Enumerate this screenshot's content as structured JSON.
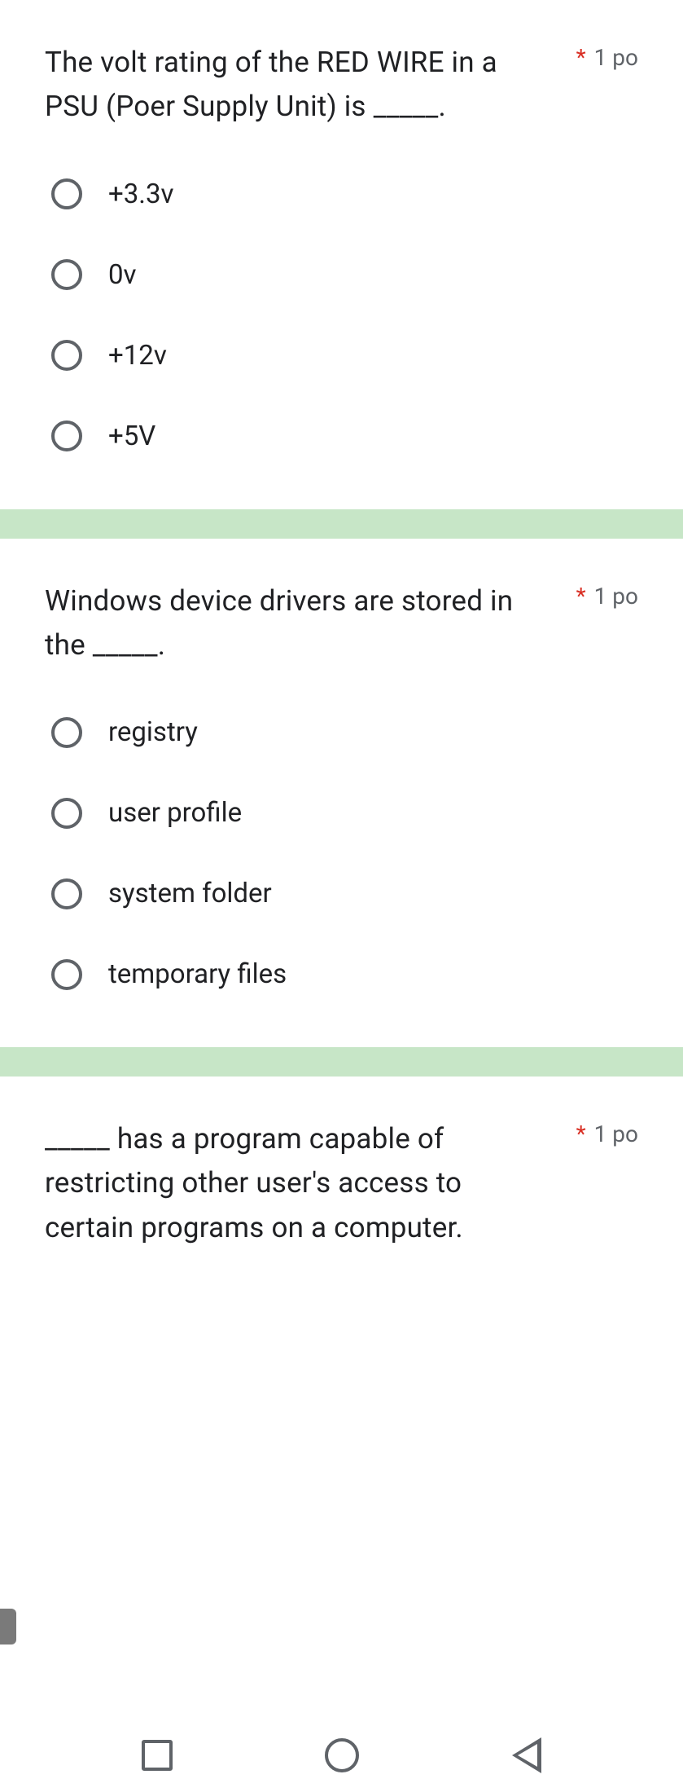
{
  "questions": [
    {
      "text": "The volt rating of the RED WIRE in a PSU (Poer Supply Unit) is _____.",
      "required": "*",
      "points": "1 po",
      "options": [
        "+3.3v",
        "0v",
        "+12v",
        "+5V"
      ]
    },
    {
      "text": "Windows device drivers are stored in the _____.",
      "required": "*",
      "points": "1 po",
      "options": [
        "registry",
        "user profile",
        "system folder",
        "temporary files"
      ]
    },
    {
      "text": "_____ has a program capable of restricting other user's access to certain programs on a computer.",
      "required": "*",
      "points": "1 po",
      "options": []
    }
  ]
}
